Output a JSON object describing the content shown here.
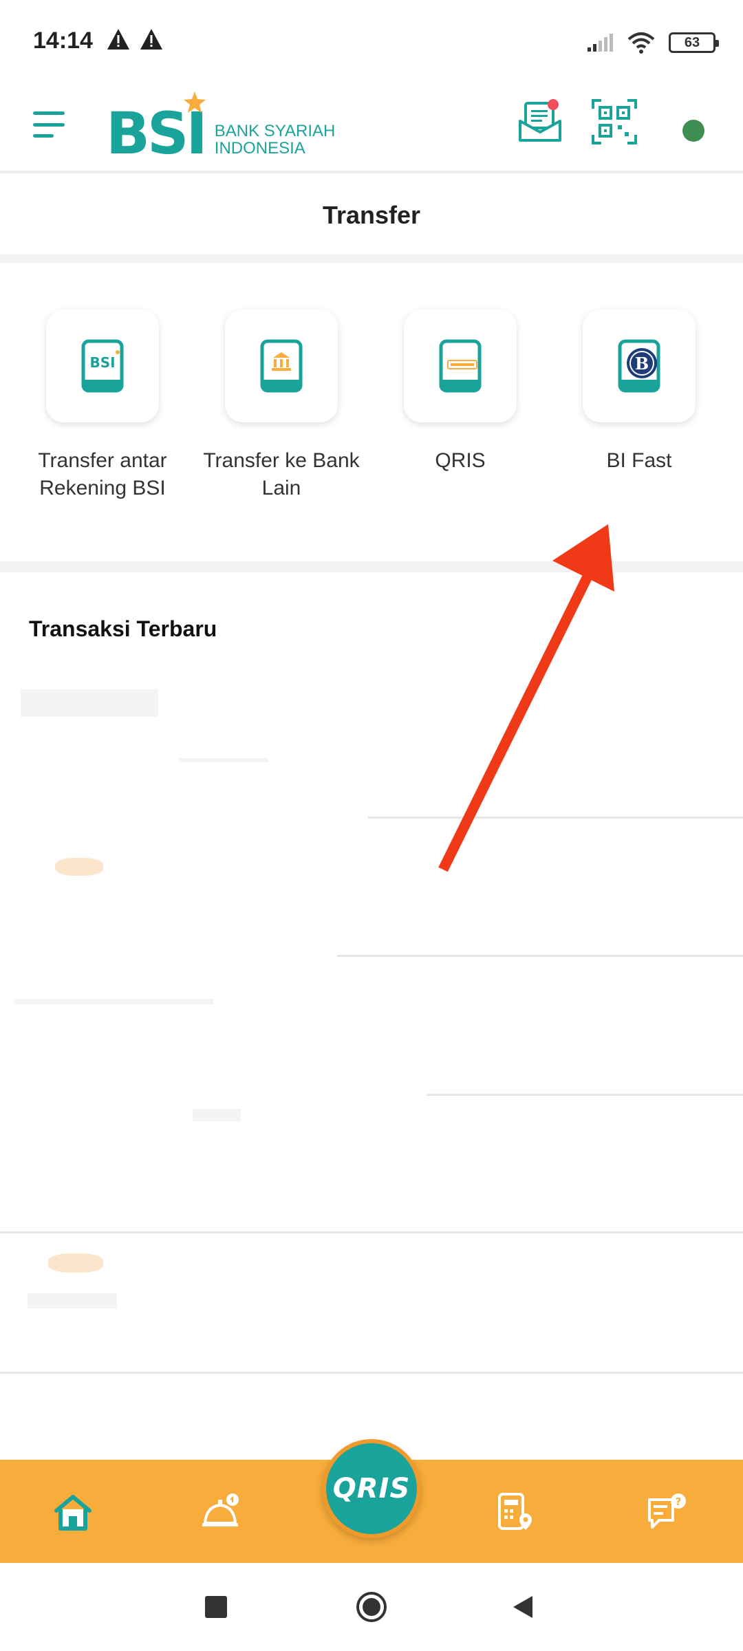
{
  "status_bar": {
    "time": "14:14",
    "battery": "63"
  },
  "header": {
    "logo_text": "BSI",
    "logo_subtitle_line1": "BANK SYARIAH",
    "logo_subtitle_line2": "INDONESIA",
    "icons": [
      "menu-icon",
      "inbox-icon",
      "qr-code-icon",
      "profile-status-dot"
    ],
    "notification_dot": true
  },
  "page": {
    "title": "Transfer"
  },
  "transfer_options": [
    {
      "label": "Transfer antar Rekening BSI",
      "icon": "bsi-transfer-icon"
    },
    {
      "label": "Transfer ke Bank Lain",
      "icon": "bank-transfer-icon"
    },
    {
      "label": "QRIS",
      "icon": "qris-icon"
    },
    {
      "label": "BI Fast",
      "icon": "bi-fast-icon"
    }
  ],
  "recent": {
    "title": "Transaksi Terbaru"
  },
  "bottom_nav": {
    "items": [
      "home-icon",
      "service-bell-icon",
      "qris-button",
      "location-icon",
      "chat-help-icon"
    ],
    "qris_label": "QRIS"
  },
  "colors": {
    "brand_teal": "#1aa39b",
    "nav_orange": "#f7ac3b",
    "arrow_red": "#f03a17",
    "profile_green": "#3e8e53"
  }
}
